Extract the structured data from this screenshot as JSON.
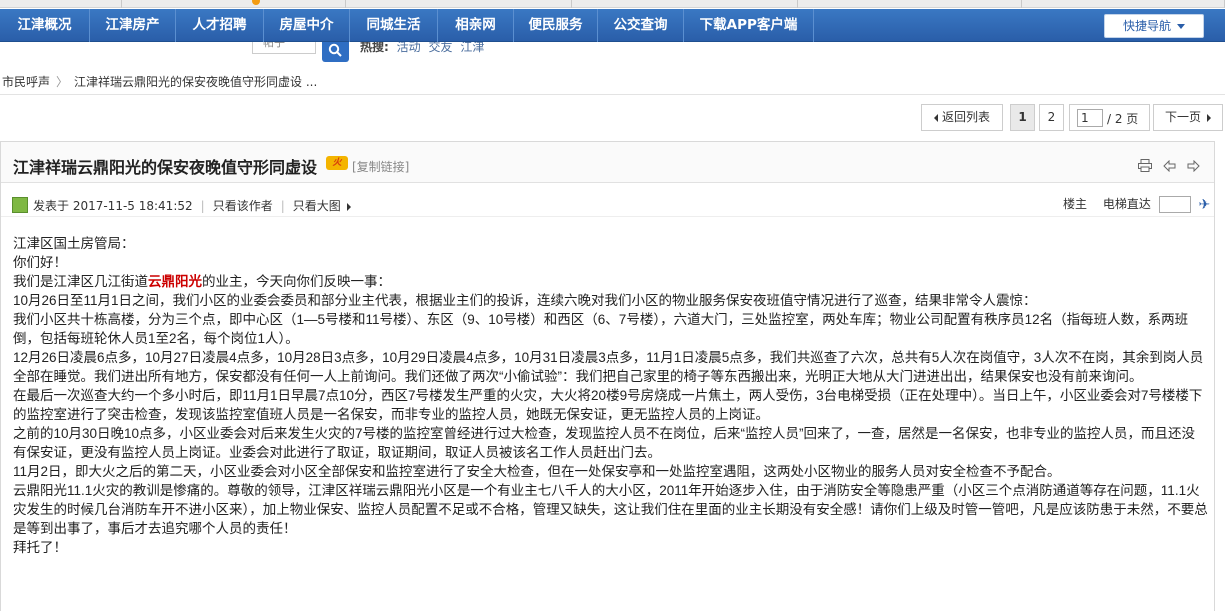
{
  "nav": {
    "items": [
      "江津概况",
      "江津房产",
      "人才招聘",
      "房屋中介",
      "同城生活",
      "相亲网",
      "便民服务",
      "公交查询",
      "下载APP客户端"
    ],
    "quick_nav": "快捷导航"
  },
  "search": {
    "type_value": "帖子",
    "hot_label": "热搜:",
    "hot_words": [
      "活动",
      "交友",
      "江津"
    ]
  },
  "breadcrumb": {
    "items": [
      "市民呼声",
      "江津祥瑞云鼎阳光的保安夜晚值守形同虚设 ..."
    ]
  },
  "pager": {
    "back": "返回列表",
    "pages": [
      "1",
      "2"
    ],
    "current_input": "1",
    "total": "/ 2 页",
    "next": "下一页"
  },
  "thread": {
    "title": "江津祥瑞云鼎阳光的保安夜晚值守形同虚设",
    "hot_badge": "火",
    "copy_link": "[复制链接]",
    "posted": "发表于 2017-11-5 18:41:52",
    "only_author": "只看该作者",
    "big_pic": "只看大图",
    "floor": "楼主",
    "elevator": "电梯直达"
  },
  "content": {
    "lines": [
      "江津区国土房管局：",
      "你们好！",
      "10月26日至11月1日之间，我们小区的业委会委员和部分业主代表，根据业主们的投诉，连续六晚对我们小区的物业服务保安夜班值守情况进行了巡查，结果非常令人震惊：",
      "我们小区共十栋高楼，分为三个点，即中心区（1—5号楼和11号楼）、东区（9、10号楼）和西区（6、7号楼），六道大门，三处监控室，两处车库；物业公司配置有秩序员12名（指每班人数，系两班倒，包括每班轮休人员1至2名，每个岗位1人）。",
      "12月26日凌晨6点多，10月27日凌晨4点多，10月28日3点多，10月29日凌晨4点多，10月31日凌晨3点多，11月1日凌晨5点多，我们共巡查了六次，总共有5人次在岗值守，3人次不在岗，其余到岗人员全部在睡觉。我们进出所有地方，保安都没有任何一人上前询问。我们还做了两次“小偷试验”：我们把自己家里的椅子等东西搬出来，光明正大地从大门进进出出，结果保安也没有前来询问。",
      "在最后一次巡查大约一个多小时后，即11月1日早晨7点10分，西区7号楼发生严重的火灾，大火将20楼9号房烧成一片焦土，两人受伤，3台电梯受损（正在处理中）。当日上午，小区业委会对7号楼楼下的监控室进行了突击检查，发现该监控室值班人员是一名保安，而非专业的监控人员，她既无保安证，更无监控人员的上岗证。",
      "之前的10月30日晚10点多，小区业委会对后来发生火灾的7号楼的监控室曾经进行过大检查，发现监控人员不在岗位，后来“监控人员”回来了，一查，居然是一名保安，也非专业的监控人员，而且还没有保安证，更没有监控人员上岗证。业委会对此进行了取证，取证期间，取证人员被该名工作人员赶出门去。",
      "11月2日，即大火之后的第二天，小区业委会对小区全部保安和监控室进行了安全大检查，但在一处保安亭和一处监控室遇阻，这两处小区物业的服务人员对安全检查不予配合。",
      "云鼎阳光11.1火灾的教训是惨痛的。尊敬的领导，江津区祥瑞云鼎阳光小区是一个有业主七八千人的大小区，2011年开始逐步入住，由于消防安全等隐患严重（小区三个点消防通道等存在问题，11.1火灾发生的时候几台消防车开不进小区来），加上物业保安、监控人员配置不足或不合格，管理又缺失，这让我们住在里面的业主长期没有安全感！请你们上级及时管一管吧，凡是应该防患于未然，不要总是等到出事了，事后才去追究哪个人员的责任！",
      "拜托了！"
    ],
    "intro_pre": "我们是江津区几江街道",
    "intro_highlight": "云鼎阳光",
    "intro_post": "的业主，今天向你们反映一事："
  }
}
